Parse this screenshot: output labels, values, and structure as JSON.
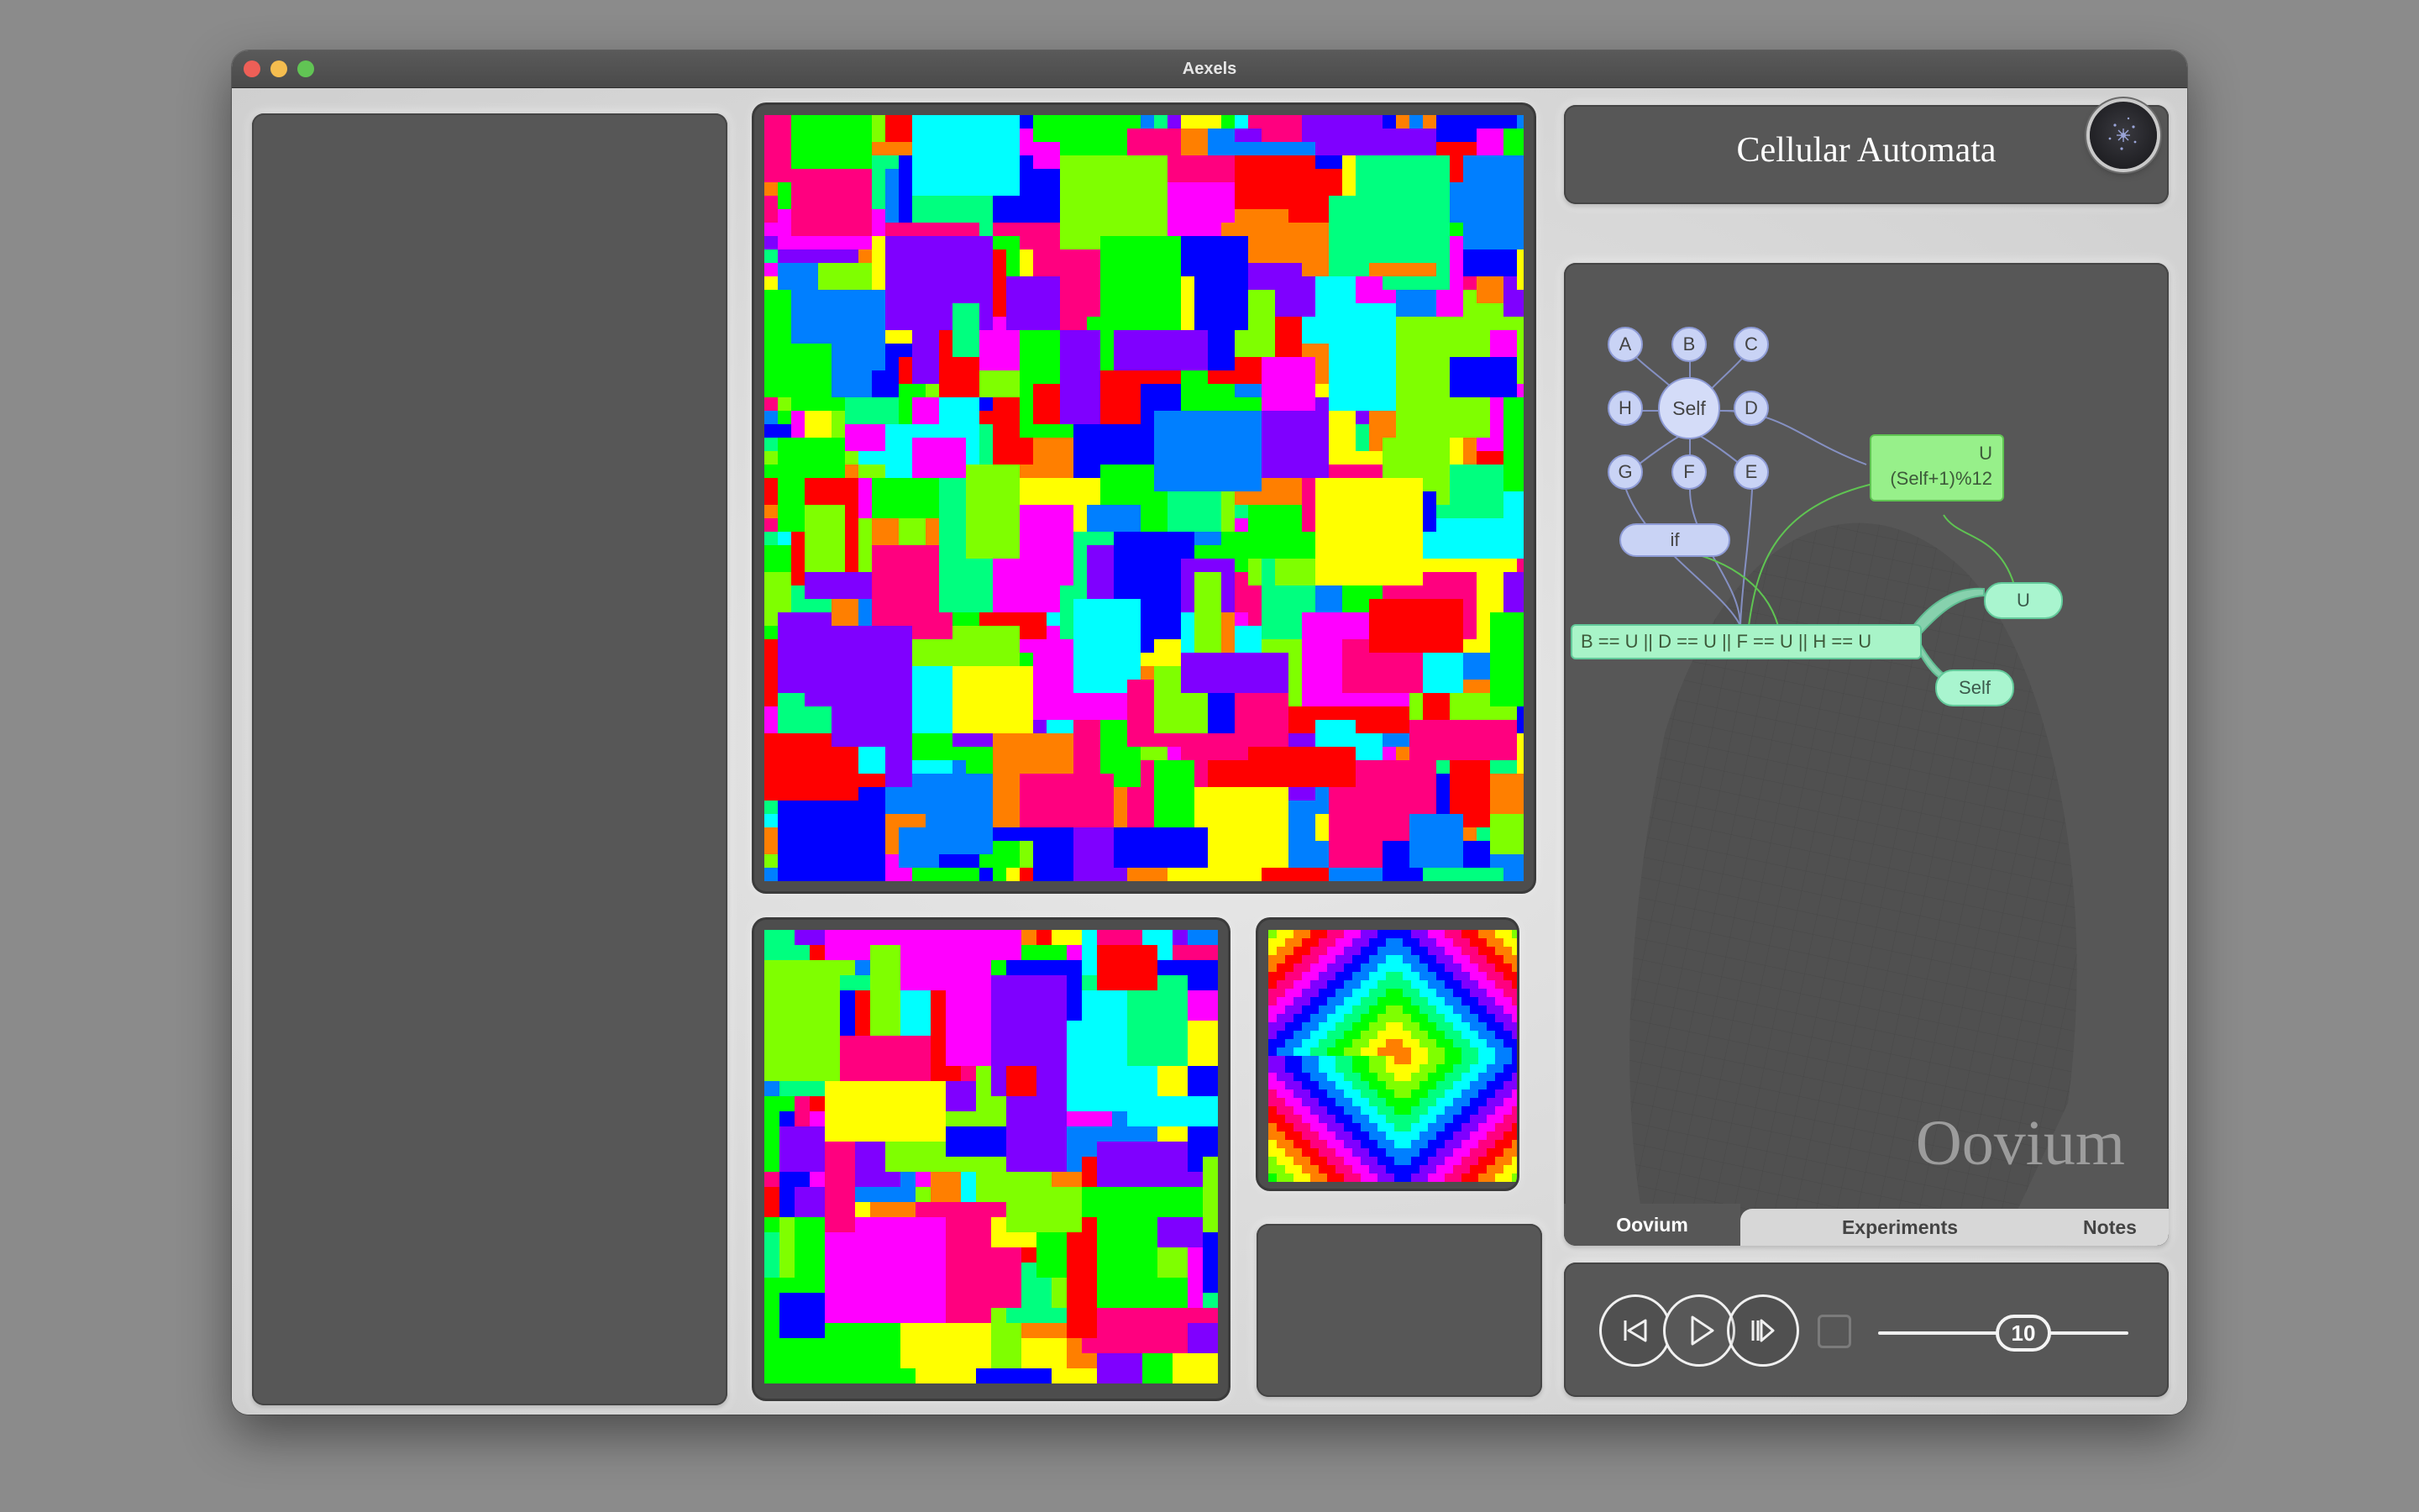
{
  "window": {
    "title": "Aexels"
  },
  "header": {
    "title": "Cellular Automata"
  },
  "oovium": {
    "neighbors": [
      "A",
      "B",
      "C",
      "H",
      "Self",
      "D",
      "G",
      "F",
      "E"
    ],
    "if_label": "if",
    "result_name": "U",
    "result_expr": "(Self+1)%12",
    "condition": "B == U || D == U || F == U || H == U",
    "then_value": "U",
    "else_value": "Self",
    "watermark": "Oovium"
  },
  "tabs": [
    {
      "label": "Oovium",
      "active": true
    },
    {
      "label": "Experiments",
      "active": false
    },
    {
      "label": "Notes",
      "active": false
    }
  ],
  "controls": {
    "speed_value": "10",
    "buttons": [
      "step-back",
      "play",
      "step-forward"
    ]
  },
  "colors": {
    "palette": [
      "#ff0000",
      "#ff7f00",
      "#ffff00",
      "#7fff00",
      "#00ff00",
      "#00ff7f",
      "#00ffff",
      "#007fff",
      "#0000ff",
      "#7f00ff",
      "#ff00ff",
      "#ff007f"
    ],
    "panel": "#575757",
    "bubble": "#c9d3f5",
    "green_box": "#97f08a",
    "mint_pill": "#a9f5cf"
  }
}
